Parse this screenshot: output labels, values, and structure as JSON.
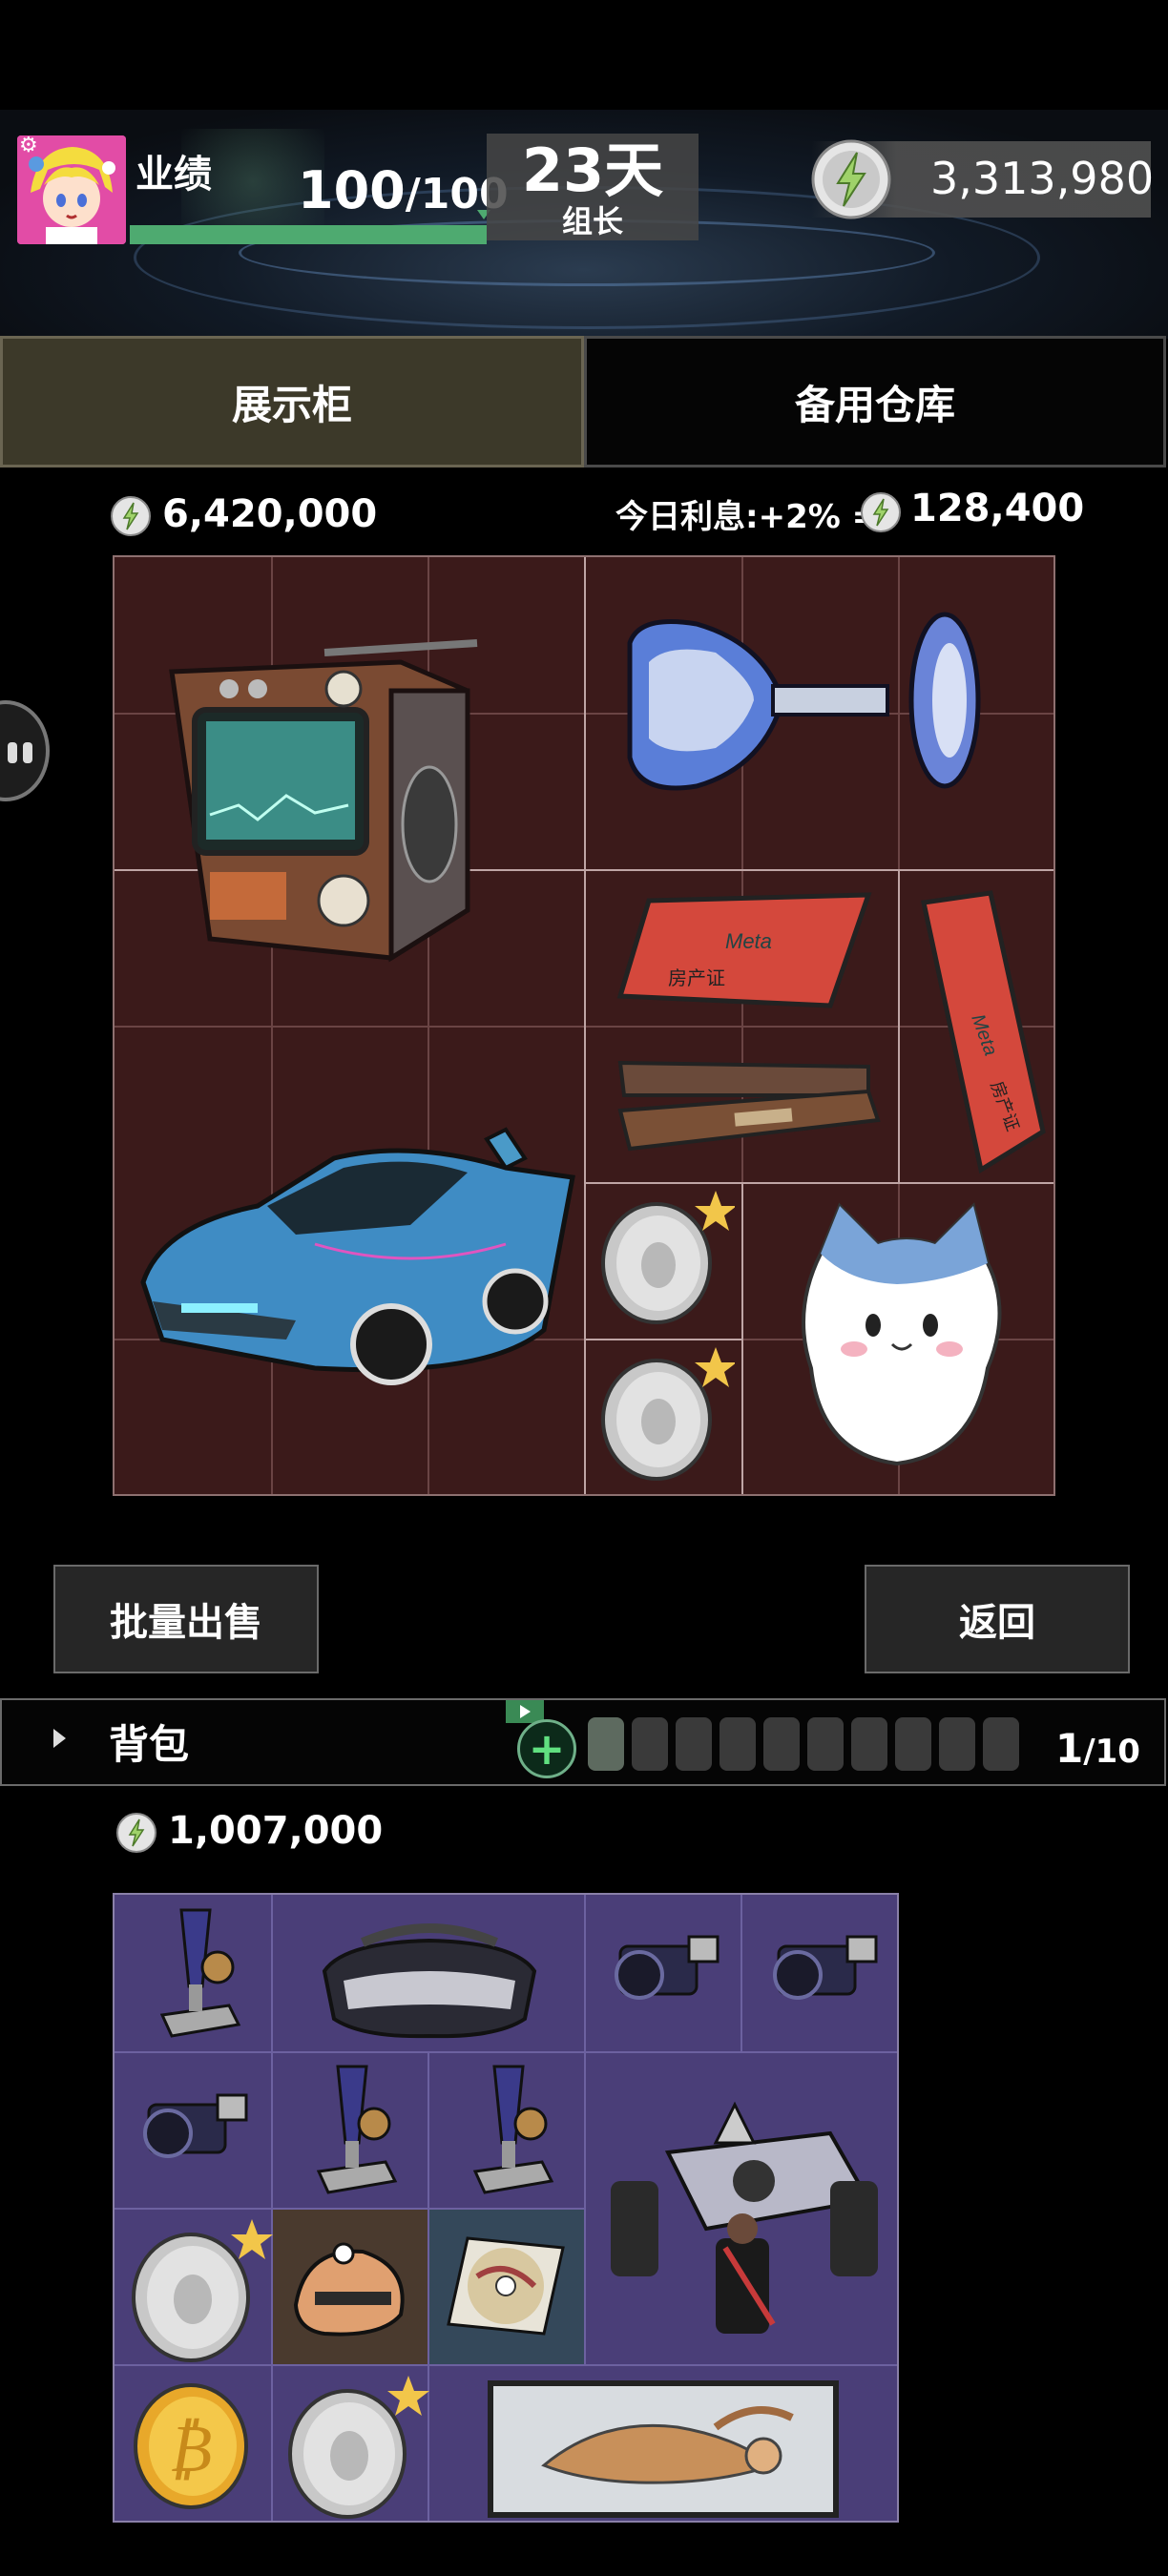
{
  "header": {
    "performance_label": "业绩",
    "performance_current": "100",
    "performance_max": "/100",
    "performance_fraction": 1.0,
    "days_value": "23天",
    "role": "组长",
    "coins": "3,313,980"
  },
  "tabs": [
    {
      "label": "展示柜",
      "active": true
    },
    {
      "label": "备用仓库",
      "active": false
    }
  ],
  "display": {
    "value": "6,420,000",
    "interest_label": "今日利息:+2% =",
    "interest_value": "128,400",
    "items": [
      {
        "name": "retro-tv-icon"
      },
      {
        "name": "crystal-goblet-icon"
      },
      {
        "name": "property-deed-icon",
        "text": "Meta",
        "subtext": "房产证"
      },
      {
        "name": "property-deed-icon",
        "text": "Meta",
        "subtext": "房产证"
      },
      {
        "name": "wooden-plaque-icon"
      },
      {
        "name": "sports-car-icon"
      },
      {
        "name": "silver-penguin-coin-icon",
        "starred": true
      },
      {
        "name": "silver-penguin-coin-icon",
        "starred": true
      },
      {
        "name": "cat-mascot-icon"
      }
    ]
  },
  "buttons": {
    "bulk_sell": "批量出售",
    "back": "返回"
  },
  "backpack": {
    "label": "背包",
    "capacity_used": "1",
    "capacity_max": "/10",
    "value": "1,007,000",
    "items": [
      {
        "name": "trophy-statue-icon"
      },
      {
        "name": "vr-headset-icon"
      },
      {
        "name": "camera-icon"
      },
      {
        "name": "camera-icon"
      },
      {
        "name": "camera-icon"
      },
      {
        "name": "trophy-statue-icon"
      },
      {
        "name": "trophy-statue-icon"
      },
      {
        "name": "pallbearers-coffin-icon"
      },
      {
        "name": "silver-penguin-coin-icon",
        "starred": true
      },
      {
        "name": "robot-helmet-icon"
      },
      {
        "name": "cd-disc-icon"
      },
      {
        "name": "bitcoin-icon"
      },
      {
        "name": "silver-penguin-coin-icon",
        "starred": true
      },
      {
        "name": "tiger-painting-icon"
      }
    ]
  },
  "colors": {
    "accent_green": "#4eaa70",
    "display_grid_bg": "#3b1a1a",
    "bag_grid_bg": "#4a3e78",
    "active_tab": "#3c3929",
    "star": "#f2c64a"
  }
}
